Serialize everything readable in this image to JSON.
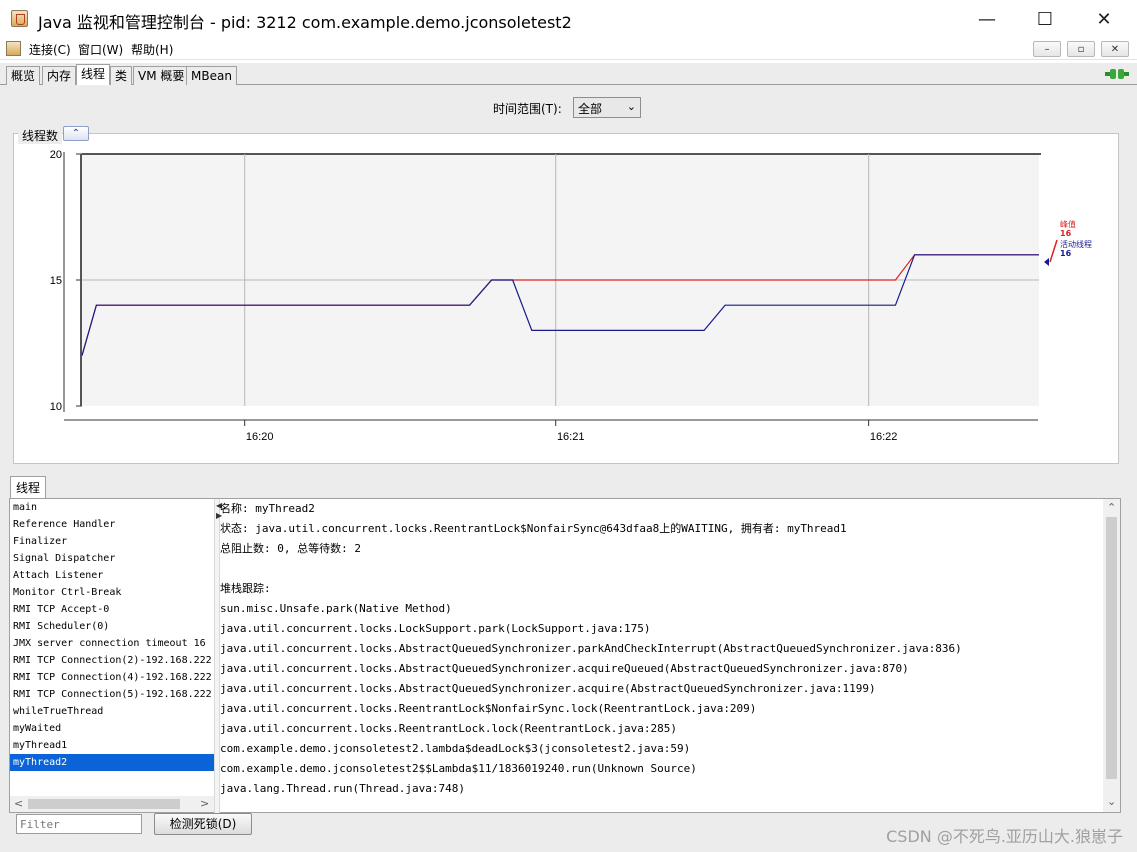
{
  "window": {
    "title": "Java 监视和管理控制台 - pid: 3212 com.example.demo.jconsoletest2",
    "minimize": "—",
    "maximize": "☐",
    "close": "✕"
  },
  "menu": {
    "items": [
      "连接(C)",
      "窗口(W)",
      "帮助(H)"
    ],
    "mdi": [
      "–",
      "▫",
      "✕"
    ]
  },
  "tabs": [
    "概览",
    "内存",
    "线程",
    "类",
    "VM 概要",
    "MBean"
  ],
  "active_tab": "线程",
  "range": {
    "label": "时间范围(T):",
    "value": "全部"
  },
  "chart_section": {
    "title": "线程数",
    "collapse_icon": "double-chevron-up-icon"
  },
  "chart_data": {
    "type": "line",
    "ylim": [
      10,
      20
    ],
    "yticks": [
      "10",
      "15",
      "20"
    ],
    "xticks": [
      "16:20",
      "16:21",
      "16:22"
    ],
    "series": [
      {
        "name": "峰值",
        "color": "#dd2020",
        "points": [
          [
            0.0,
            12
          ],
          [
            0.015,
            14
          ],
          [
            0.405,
            14
          ],
          [
            0.428,
            15
          ],
          [
            0.85,
            15
          ],
          [
            0.87,
            16
          ],
          [
            1.0,
            16
          ]
        ]
      },
      {
        "name": "活动线程",
        "color": "#1a1a8e",
        "points": [
          [
            0.0,
            12
          ],
          [
            0.015,
            14
          ],
          [
            0.405,
            14
          ],
          [
            0.428,
            15
          ],
          [
            0.45,
            15
          ],
          [
            0.47,
            13
          ],
          [
            0.65,
            13
          ],
          [
            0.672,
            14
          ],
          [
            0.85,
            14
          ],
          [
            0.87,
            16
          ],
          [
            1.0,
            16
          ]
        ]
      }
    ],
    "legend": [
      {
        "name": "峰值",
        "value": "16",
        "color": "#dd2020"
      },
      {
        "name": "活动线程",
        "value": "16",
        "color": "#1a1a8e"
      }
    ]
  },
  "thread_tab": "线程",
  "threads": [
    "main",
    "Reference Handler",
    "Finalizer",
    "Signal Dispatcher",
    "Attach Listener",
    "Monitor Ctrl-Break",
    "RMI TCP Accept-0",
    "RMI Scheduler(0)",
    "JMX server connection timeout 16",
    "RMI TCP Connection(2)-192.168.222",
    "RMI TCP Connection(4)-192.168.222",
    "RMI TCP Connection(5)-192.168.222",
    "whileTrueThread",
    "myWaited",
    "myThread1",
    "myThread2"
  ],
  "selected_thread": "myThread2",
  "detail": [
    "名称: myThread2",
    "状态: java.util.concurrent.locks.ReentrantLock$NonfairSync@643dfaa8上的WAITING, 拥有者: myThread1",
    "总阻止数: 0, 总等待数: 2",
    "",
    "堆栈跟踪:",
    "sun.misc.Unsafe.park(Native Method)",
    "java.util.concurrent.locks.LockSupport.park(LockSupport.java:175)",
    "java.util.concurrent.locks.AbstractQueuedSynchronizer.parkAndCheckInterrupt(AbstractQueuedSynchronizer.java:836)",
    "java.util.concurrent.locks.AbstractQueuedSynchronizer.acquireQueued(AbstractQueuedSynchronizer.java:870)",
    "java.util.concurrent.locks.AbstractQueuedSynchronizer.acquire(AbstractQueuedSynchronizer.java:1199)",
    "java.util.concurrent.locks.ReentrantLock$NonfairSync.lock(ReentrantLock.java:209)",
    "java.util.concurrent.locks.ReentrantLock.lock(ReentrantLock.java:285)",
    "com.example.demo.jconsoletest2.lambda$deadLock$3(jconsoletest2.java:59)",
    "com.example.demo.jconsoletest2$$Lambda$11/1836019240.run(Unknown Source)",
    "java.lang.Thread.run(Thread.java:748)"
  ],
  "filter": {
    "placeholder": "Filter"
  },
  "detect_button": "检测死锁(D)",
  "watermark": "CSDN @不死鸟.亚历山大.狼崽子"
}
